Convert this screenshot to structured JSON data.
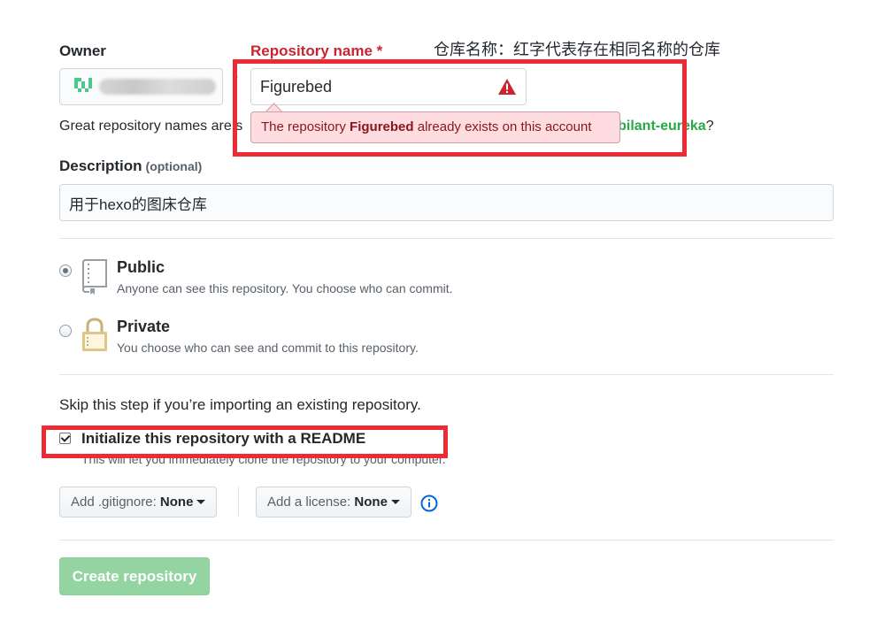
{
  "form": {
    "owner_label": "Owner",
    "repo_name_label": "Repository name *",
    "repo_name_value": "Figurebed",
    "slash": "/",
    "error": {
      "prefix": "The repository ",
      "name": "Figurebed",
      "suffix": " already exists on this account"
    },
    "great_names": {
      "text": "Great repository names are s",
      "suggestion": "bilant-eureka",
      "end": "?"
    },
    "description_label": "Description",
    "description_optional": "(optional)",
    "description_value": "用于hexo的图床仓库",
    "visibility": {
      "public_title": "Public",
      "public_desc": "Anyone can see this repository. You choose who can commit.",
      "private_title": "Private",
      "private_desc": "You choose who can see and commit to this repository.",
      "selected": "public"
    },
    "skip_text": "Skip this step if you’re importing an existing repository.",
    "readme_label": "Initialize this repository with a README",
    "readme_desc": "This will let you immediately clone the repository to your computer.",
    "readme_checked": true,
    "gitignore_prefix": "Add .gitignore: ",
    "gitignore_value": "None",
    "license_prefix": "Add a license: ",
    "license_value": "None",
    "create_button": "Create repository"
  },
  "annotation": "仓库名称：红字代表存在相同名称的仓库",
  "colors": {
    "error_red": "#cb2431",
    "annotation_box": "#ed2b34",
    "suggestion_green": "#28a745",
    "create_disabled": "#94d3a2"
  },
  "icons": [
    "warning-icon",
    "repo-icon",
    "lock-icon",
    "info-icon",
    "caret-down-icon",
    "identicon"
  ]
}
